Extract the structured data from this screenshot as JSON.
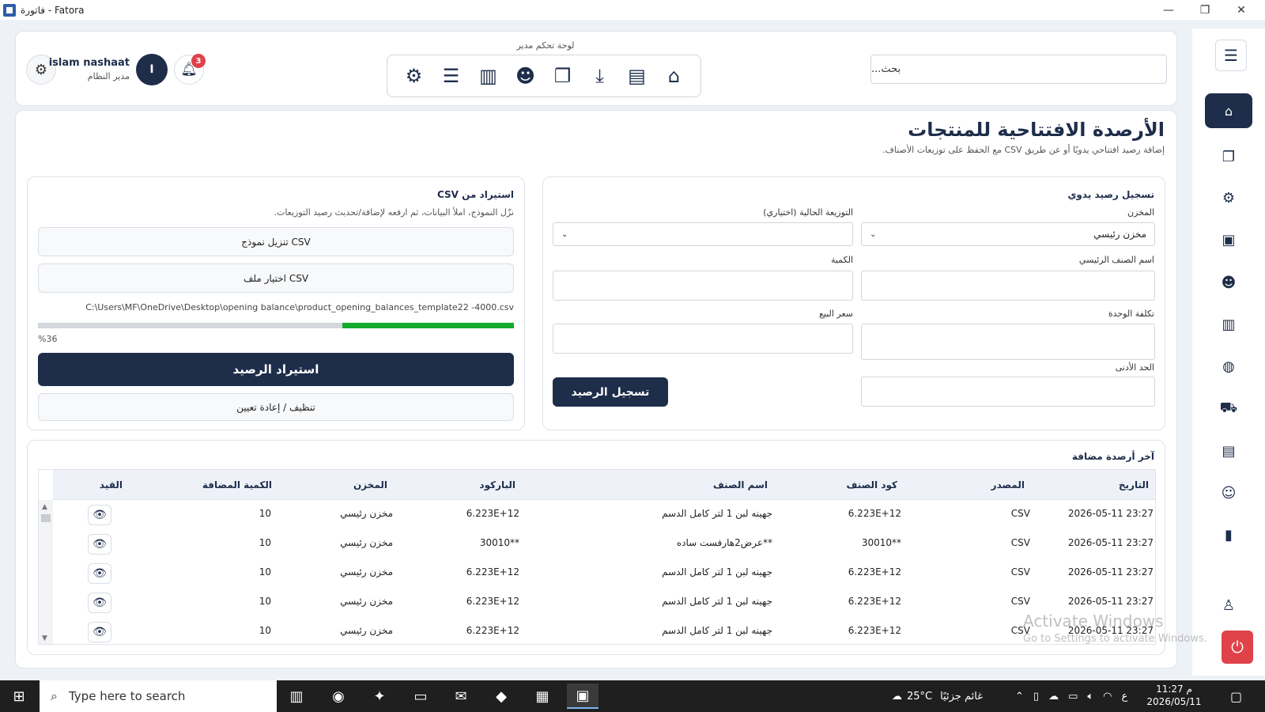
{
  "window": {
    "title": "فاتورة - Fatora",
    "minimize": "—",
    "maximize": "❐",
    "close": "✕"
  },
  "header": {
    "search_placeholder": "بحث...",
    "dashboard_label": "لوحة تحكم مدير",
    "user_name": "islam nashaat",
    "user_role": "مدير النظام",
    "avatar_initial": "I",
    "notification_count": "3"
  },
  "page": {
    "title": "الأرصدة الافتتاحية للمنتجات",
    "subtitle": "إضافة رصيد افتتاحي يدويًا أو عن طريق CSV مع الحفظ على توزيعات الأصناف."
  },
  "manual": {
    "title": "تسجيل رصيد يدوي",
    "warehouse_label": "المخزن",
    "warehouse_value": "مخزن رئيسي",
    "distribution_label": "التوزيعة الحالية (اختياري)",
    "distribution_value": "",
    "item_name_label": "اسم الصنف الرئيسي",
    "quantity_label": "الكمية",
    "unit_cost_label": "تكلفة الوحدة",
    "sale_price_label": "سعر البيع",
    "min_label": "الحد الأدنى",
    "submit_label": "تسجيل الرصيد"
  },
  "csv": {
    "title": "استيراد من CSV",
    "hint": "نزّل النموذج، املأ البيانات، ثم ارفعه لإضافة/تحديث رصيد التوزيعات.",
    "download_label": "تنزيل نموذج CSV",
    "choose_label": "اختيار ملف CSV",
    "file_path": "C:\\Users\\MF\\OneDrive\\Desktop\\opening balance\\product_opening_balances_template22 -4000.csv",
    "progress": 0.36,
    "progress_text": "%36",
    "import_label": "استيراد الرصيد",
    "reset_label": "تنظيف / إعادة تعيين"
  },
  "recent": {
    "title": "آخر أرصدة مضافة",
    "columns": {
      "date": "التاريخ",
      "source": "المصدر",
      "code": "كود الصنف",
      "name": "اسم الصنف",
      "barcode": "الباركود",
      "warehouse": "المخزن",
      "qty": "الكمية المضافة",
      "entry": "القيد"
    },
    "rows": [
      {
        "date": "2026-05-11 23:27",
        "source": "CSV",
        "code": "6.223E+12",
        "name": "جهينه لبن 1 لتر كامل الدسم",
        "barcode": "6.223E+12",
        "warehouse": "مخزن رئيسي",
        "qty": "10"
      },
      {
        "date": "2026-05-11 23:27",
        "source": "CSV",
        "code": "30010**",
        "name": "عرض2هارفست ساده**",
        "barcode": "30010**",
        "warehouse": "مخزن رئيسي",
        "qty": "10"
      },
      {
        "date": "2026-05-11 23:27",
        "source": "CSV",
        "code": "6.223E+12",
        "name": "جهينه لبن 1 لتر كامل الدسم",
        "barcode": "6.223E+12",
        "warehouse": "مخزن رئيسي",
        "qty": "10"
      },
      {
        "date": "2026-05-11 23:27",
        "source": "CSV",
        "code": "6.223E+12",
        "name": "جهينه لبن 1 لتر كامل الدسم",
        "barcode": "6.223E+12",
        "warehouse": "مخزن رئيسي",
        "qty": "10"
      },
      {
        "date": "2026-05-11 23:27",
        "source": "CSV",
        "code": "6.223E+12",
        "name": "جهينه لبن 1 لتر كامل الدسم",
        "barcode": "6.223E+12",
        "warehouse": "مخزن رئيسي",
        "qty": "10"
      }
    ]
  },
  "watermark": {
    "line1": "Activate Windows",
    "line2": "Go to Settings to activate Windows."
  },
  "taskbar": {
    "search_placeholder": "Type here to search",
    "weather_temp": "25°C",
    "weather_text": "غائم جزئيًا",
    "time": "11:27 م",
    "date": "2026/05/11",
    "lang": "ع"
  },
  "colors": {
    "primary": "#1e2d4a",
    "progress": "#13ab2e",
    "danger": "#e0424a"
  }
}
